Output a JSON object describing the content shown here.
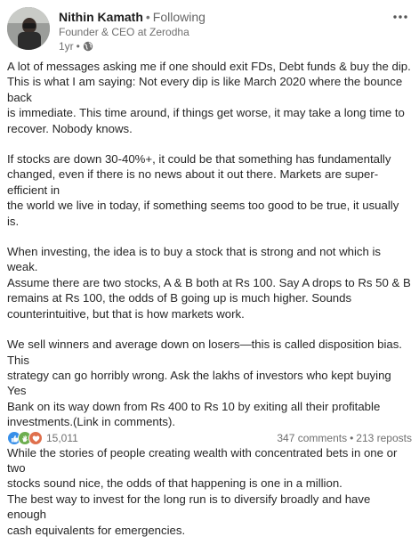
{
  "author": {
    "name": "Nithin Kamath",
    "follow_separator": "•",
    "follow_status": "Following",
    "headline": "Founder & CEO at Zerodha",
    "time": "1yr",
    "time_separator": "•",
    "visibility_icon": "globe-icon"
  },
  "menu": {
    "icon": "more-horizontal-icon"
  },
  "post": {
    "paragraphs": [
      "A lot of messages asking me if one should exit FDs, Debt funds & buy the dip.\nThis is what I am saying: Not every dip is like March 2020 where the bounce back\nis immediate. This time around, if things get worse, it may take a long time to\nrecover. Nobody knows.",
      "If stocks are down 30-40%+, it could be that something has fundamentally\nchanged, even if there is no news about it out there. Markets are super-efficient in\nthe world we live in today, if something seems too good to be true, it usually is.",
      "When investing, the idea is to buy a stock that is strong and not which is weak.\nAssume there are two stocks, A & B both at Rs 100. Say A drops to Rs 50 & B\nremains at Rs 100, the odds of B going up is much higher. Sounds\ncounterintuitive, but that is how markets work.",
      "We sell winners and average down on losers—this is called disposition bias. This\nstrategy can go horribly wrong. Ask the lakhs of investors who kept buying Yes\nBank on its way down from Rs 400 to Rs 10 by exiting all their profitable\ninvestments.(Link in comments).",
      "While the stories of people creating wealth with concentrated bets in one or two\nstocks sound nice, the odds of that happening is one in a million.\nThe best way to invest for the long run is to diversify broadly and have enough\ncash equivalents for emergencies."
    ]
  },
  "social": {
    "reaction_icons": [
      "like-icon",
      "clap-icon",
      "heart-icon"
    ],
    "reaction_count": "15,011",
    "comments": "347 comments",
    "separator": "•",
    "reposts": "213 reposts"
  },
  "colors": {
    "like": "#378fe9",
    "celebrate": "#6dae4f",
    "love": "#df704d",
    "text": "#262626",
    "muted": "#6f6f6f"
  }
}
